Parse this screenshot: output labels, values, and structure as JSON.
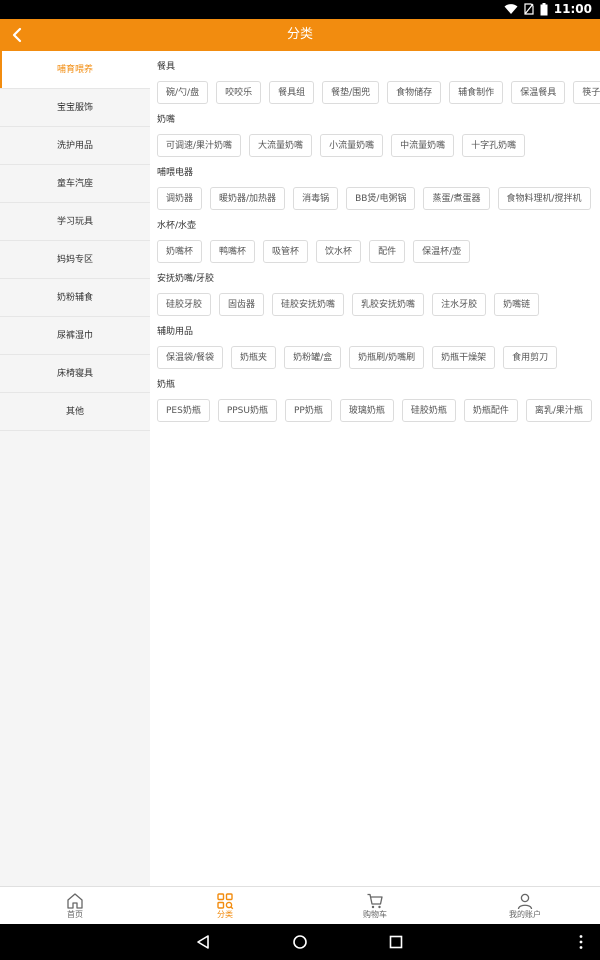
{
  "status": {
    "time": "11:00"
  },
  "header": {
    "title": "分类"
  },
  "sidebar": {
    "items": [
      {
        "label": "哺育喂养"
      },
      {
        "label": "宝宝服饰"
      },
      {
        "label": "洗护用品"
      },
      {
        "label": "童车汽座"
      },
      {
        "label": "学习玩具"
      },
      {
        "label": "妈妈专区"
      },
      {
        "label": "奶粉辅食"
      },
      {
        "label": "尿裤湿巾"
      },
      {
        "label": "床椅寝具"
      },
      {
        "label": "其他"
      }
    ]
  },
  "sections": [
    {
      "title": "餐具",
      "tags": [
        "碗/勺/盘",
        "咬咬乐",
        "餐具组",
        "餐垫/围兜",
        "食物储存",
        "辅食制作",
        "保温餐具",
        "筷子"
      ]
    },
    {
      "title": "奶嘴",
      "tags": [
        "可调速/果汁奶嘴",
        "大流量奶嘴",
        "小流量奶嘴",
        "中流量奶嘴",
        "十字孔奶嘴"
      ]
    },
    {
      "title": "哺喂电器",
      "tags": [
        "调奶器",
        "暖奶器/加热器",
        "消毒锅",
        "BB煲/电粥锅",
        "蒸蛋/煮蛋器",
        "食物料理机/搅拌机"
      ]
    },
    {
      "title": "水杯/水壶",
      "tags": [
        "奶嘴杯",
        "鸭嘴杯",
        "吸管杯",
        "饮水杯",
        "配件",
        "保温杯/壶"
      ]
    },
    {
      "title": "安抚奶嘴/牙胶",
      "tags": [
        "硅胶牙胶",
        "固齿器",
        "硅胶安抚奶嘴",
        "乳胶安抚奶嘴",
        "注水牙胶",
        "奶嘴链"
      ]
    },
    {
      "title": "辅助用品",
      "tags": [
        "保温袋/餐袋",
        "奶瓶夹",
        "奶粉罐/盒",
        "奶瓶刷/奶嘴刷",
        "奶瓶干燥架",
        "食用剪刀"
      ]
    },
    {
      "title": "奶瓶",
      "tags": [
        "PES奶瓶",
        "PPSU奶瓶",
        "PP奶瓶",
        "玻璃奶瓶",
        "硅胶奶瓶",
        "奶瓶配件",
        "离乳/果汁瓶"
      ]
    }
  ],
  "bottom_nav": {
    "home": "首页",
    "category": "分类",
    "cart": "购物车",
    "account": "我的账户"
  },
  "colors": {
    "accent": "#f28c0f"
  }
}
